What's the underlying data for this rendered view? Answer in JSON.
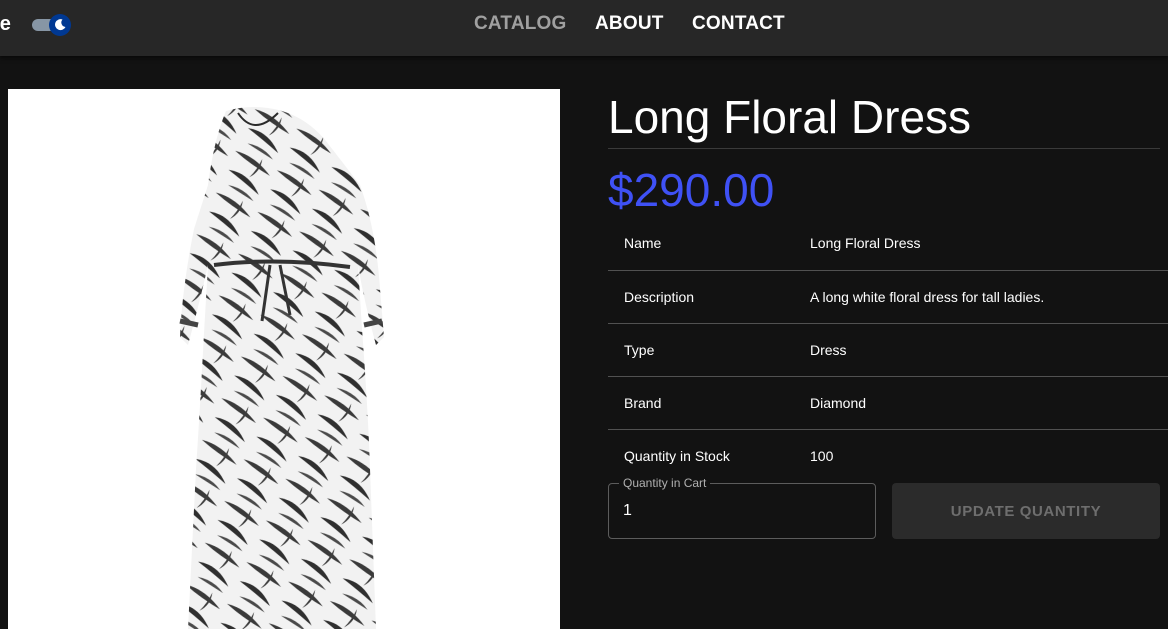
{
  "header": {
    "brand_fragment": "re",
    "dark_mode_toggle": {
      "state": "on",
      "icon": "moon-icon",
      "thumb_color": "#003892"
    },
    "nav": [
      {
        "label": "CATALOG",
        "active": true
      },
      {
        "label": "ABOUT"
      },
      {
        "label": "CONTACT"
      }
    ]
  },
  "product": {
    "image_icon": "floral-dress-image",
    "title": "Long Floral Dress",
    "price": "$290.00",
    "price_color": "#3f51f5",
    "details": [
      {
        "label": "Name",
        "value": "Long Floral Dress"
      },
      {
        "label": "Description",
        "value": "A long white floral dress for tall ladies."
      },
      {
        "label": "Type",
        "value": "Dress"
      },
      {
        "label": "Brand",
        "value": "Diamond"
      },
      {
        "label": "Quantity in Stock",
        "value": "100"
      }
    ]
  },
  "cart": {
    "quantity_label": "Quantity in Cart",
    "quantity_value": "1",
    "update_button_label": "UPDATE QUANTITY",
    "update_button_disabled": true
  }
}
